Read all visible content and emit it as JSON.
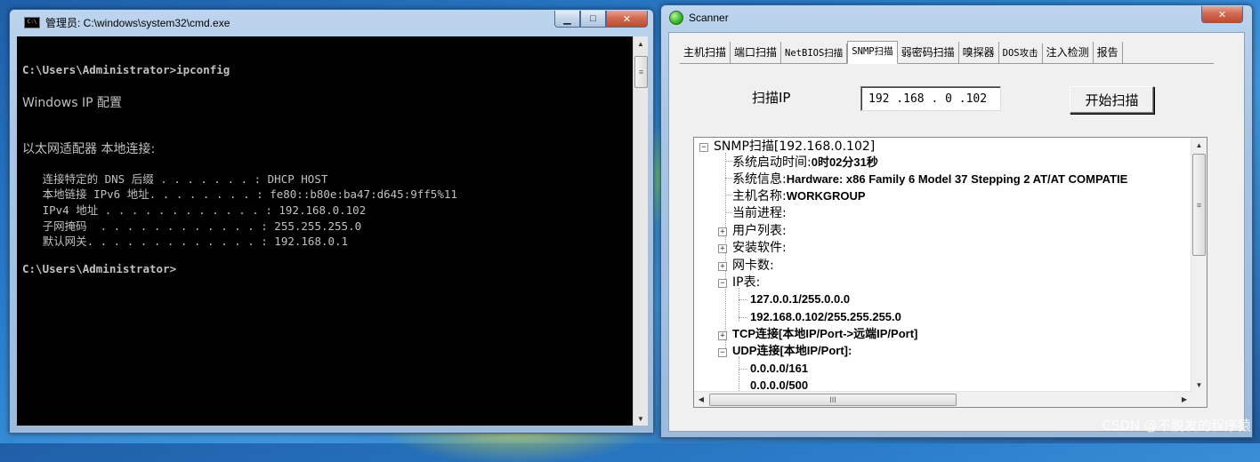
{
  "cmd_window": {
    "title": "管理员: C:\\windows\\system32\\cmd.exe",
    "icon_label": "C:\\",
    "controls": {
      "minimize": "▁",
      "maximize": "□",
      "close": "✕"
    },
    "lines": [
      "C:\\Users\\Administrator>ipconfig",
      "Windows IP 配置",
      "以太网适配器 本地连接:",
      "   连接特定的 DNS 后缀 . . . . . . . : DHCP HOST",
      "   本地链接 IPv6 地址. . . . . . . . : fe80::b80e:ba47:d645:9ff5%11",
      "   IPv4 地址 . . . . . . . . . . . . : 192.168.0.102",
      "   子网掩码  . . . . . . . . . . . . : 255.255.255.0",
      "   默认网关. . . . . . . . . . . . . : 192.168.0.1",
      "C:\\Users\\Administrator>"
    ],
    "scroll_up": "▲",
    "scroll_down": "▼",
    "scroll_grip": "≡"
  },
  "scanner_window": {
    "title": "Scanner",
    "controls": {
      "close": "✕"
    },
    "tabs": [
      "主机扫描",
      "端口扫描",
      "NetBIOS扫描",
      "SNMP扫描",
      "弱密码扫描",
      "嗅探器",
      "DOS攻击",
      "注入检测",
      "报告"
    ],
    "active_tab": "SNMP扫描",
    "ip_label": "扫描IP",
    "ip_value": "192 .168 .  0  .102",
    "scan_button": "开始扫描",
    "tree": {
      "root": "SNMP扫描[192.168.0.102]",
      "uptime_label": "系统启动时间:",
      "uptime_value": "0时02分31秒",
      "sysinfo_label": "系统信息:",
      "sysinfo_value": "Hardware: x86 Family 6 Model 37 Stepping 2 AT/AT COMPATIE",
      "hostname_label": "主机名称:",
      "hostname_value": "WORKGROUP",
      "processes": "当前进程:",
      "users": "用户列表:",
      "software": "安装软件:",
      "nics": "网卡数:",
      "ip_table": "IP表:",
      "ip_entries": [
        "127.0.0.1/255.0.0.0",
        "192.168.0.102/255.255.255.0"
      ],
      "tcp": "TCP连接[本地IP/Port->远端IP/Port]",
      "udp": "UDP连接[本地IP/Port]:",
      "udp_entries": [
        "0.0.0.0/161",
        "0.0.0.0/500"
      ],
      "expand_plus": "+",
      "expand_minus": "−"
    },
    "scroll_up": "▲",
    "scroll_down": "▼",
    "scroll_left": "◀",
    "scroll_right": "▶",
    "scroll_grip_v": "≡",
    "scroll_grip_h": "III"
  },
  "watermark": "CSDN @不脱发的程序猿"
}
